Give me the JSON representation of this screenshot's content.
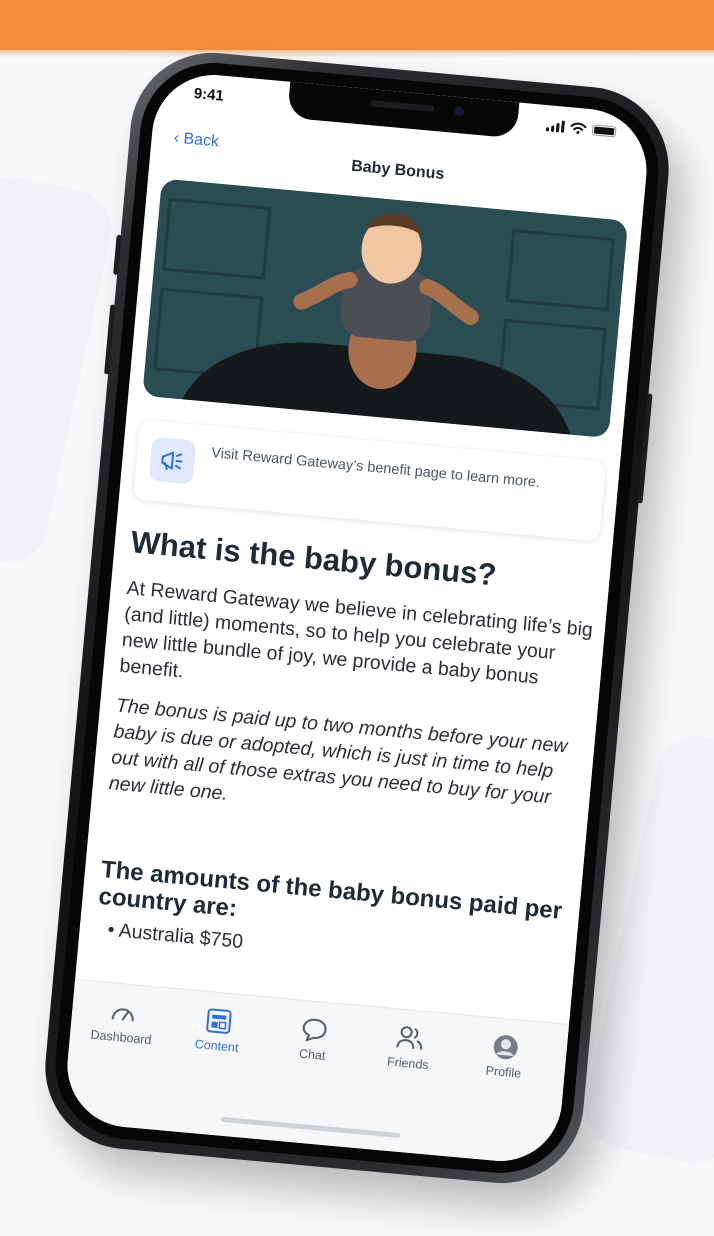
{
  "status_bar": {
    "time": "9:41"
  },
  "nav": {
    "back_label": "Back",
    "title": "Baby Bonus"
  },
  "hero_image": {
    "alt": "Man carrying a smiling baby on his shoulders"
  },
  "info_card": {
    "icon": "megaphone-icon",
    "text": "Visit Reward Gateway’s benefit page to learn more."
  },
  "article": {
    "heading": "What is the baby bonus?",
    "paragraph_1": "At Reward Gateway we believe in celebrating life’s big (and little) moments, so to help you celebrate your new little bundle of joy, we provide a baby bonus benefit.",
    "paragraph_2": "The bonus is paid up to two months before your new baby is due or adopted, which is just in time to help out with all of those extras you need to buy for your new little one.",
    "subheading": "The amounts of the baby bonus paid per country are:",
    "list_item_1": "Australia $750"
  },
  "tab_bar": {
    "active": "Content",
    "tabs": [
      {
        "label": "Dashboard",
        "icon": "speedometer-icon"
      },
      {
        "label": "Content",
        "icon": "content-icon"
      },
      {
        "label": "Chat",
        "icon": "chat-bubble-icon"
      },
      {
        "label": "Friends",
        "icon": "friends-icon"
      },
      {
        "label": "Profile",
        "icon": "avatar"
      }
    ]
  },
  "colors": {
    "accent": "#2f6fe0",
    "brand_orange": "#f58d3c",
    "heading": "#1f2937",
    "body_text": "#2b2f36"
  }
}
